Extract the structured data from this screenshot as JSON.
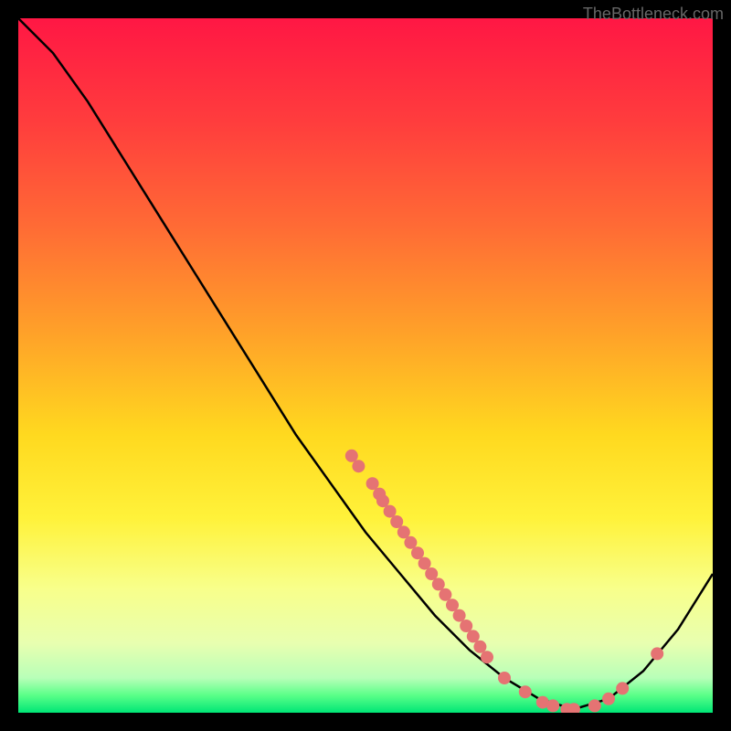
{
  "watermark": "TheBottleneck.com",
  "chart_data": {
    "type": "line",
    "title": "",
    "xlabel": "",
    "ylabel": "",
    "x": [
      0.0,
      0.05,
      0.1,
      0.15,
      0.2,
      0.25,
      0.3,
      0.35,
      0.4,
      0.45,
      0.5,
      0.55,
      0.6,
      0.65,
      0.7,
      0.75,
      0.8,
      0.85,
      0.9,
      0.95,
      1.0
    ],
    "values": [
      1.0,
      0.95,
      0.88,
      0.8,
      0.72,
      0.64,
      0.56,
      0.48,
      0.4,
      0.33,
      0.26,
      0.2,
      0.14,
      0.09,
      0.05,
      0.02,
      0.005,
      0.02,
      0.06,
      0.12,
      0.2
    ],
    "xlim": [
      0,
      1
    ],
    "ylim": [
      0,
      1
    ],
    "gradient_stops": [
      {
        "offset": 0.0,
        "color": "#ff1744"
      },
      {
        "offset": 0.15,
        "color": "#ff3d3d"
      },
      {
        "offset": 0.3,
        "color": "#ff6b35"
      },
      {
        "offset": 0.45,
        "color": "#ffa029"
      },
      {
        "offset": 0.6,
        "color": "#ffd91f"
      },
      {
        "offset": 0.72,
        "color": "#fff23a"
      },
      {
        "offset": 0.82,
        "color": "#f8ff8a"
      },
      {
        "offset": 0.9,
        "color": "#e8ffb0"
      },
      {
        "offset": 0.95,
        "color": "#b8ffb8"
      },
      {
        "offset": 0.975,
        "color": "#5aff88"
      },
      {
        "offset": 1.0,
        "color": "#00e676"
      }
    ],
    "highlight_points": [
      {
        "x": 0.48,
        "y": 0.37
      },
      {
        "x": 0.49,
        "y": 0.355
      },
      {
        "x": 0.51,
        "y": 0.33
      },
      {
        "x": 0.52,
        "y": 0.315
      },
      {
        "x": 0.525,
        "y": 0.305
      },
      {
        "x": 0.535,
        "y": 0.29
      },
      {
        "x": 0.545,
        "y": 0.275
      },
      {
        "x": 0.555,
        "y": 0.26
      },
      {
        "x": 0.565,
        "y": 0.245
      },
      {
        "x": 0.575,
        "y": 0.23
      },
      {
        "x": 0.585,
        "y": 0.215
      },
      {
        "x": 0.595,
        "y": 0.2
      },
      {
        "x": 0.605,
        "y": 0.185
      },
      {
        "x": 0.615,
        "y": 0.17
      },
      {
        "x": 0.625,
        "y": 0.155
      },
      {
        "x": 0.635,
        "y": 0.14
      },
      {
        "x": 0.645,
        "y": 0.125
      },
      {
        "x": 0.655,
        "y": 0.11
      },
      {
        "x": 0.665,
        "y": 0.095
      },
      {
        "x": 0.675,
        "y": 0.08
      },
      {
        "x": 0.7,
        "y": 0.05
      },
      {
        "x": 0.73,
        "y": 0.03
      },
      {
        "x": 0.755,
        "y": 0.015
      },
      {
        "x": 0.77,
        "y": 0.01
      },
      {
        "x": 0.79,
        "y": 0.005
      },
      {
        "x": 0.8,
        "y": 0.005
      },
      {
        "x": 0.83,
        "y": 0.01
      },
      {
        "x": 0.85,
        "y": 0.02
      },
      {
        "x": 0.87,
        "y": 0.035
      },
      {
        "x": 0.92,
        "y": 0.085
      }
    ]
  }
}
